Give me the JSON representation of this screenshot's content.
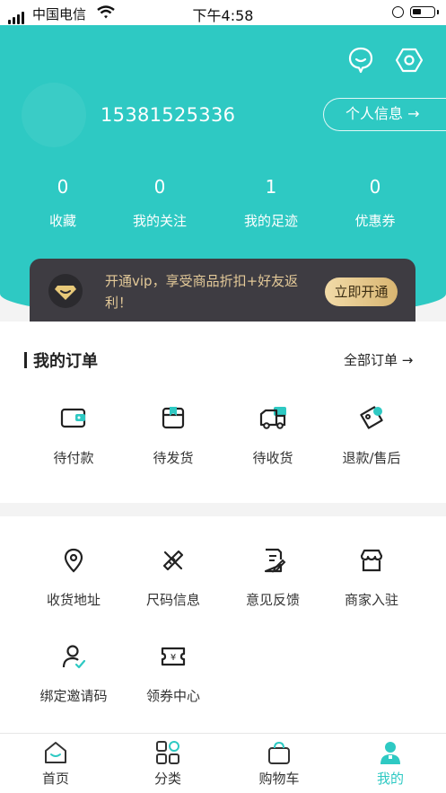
{
  "status_bar": {
    "carrier": "中国电信",
    "time": "下午4:58"
  },
  "profile": {
    "phone": "15381525336",
    "info_button": "个人信息 →"
  },
  "stats": [
    {
      "value": "0",
      "label": "收藏"
    },
    {
      "value": "0",
      "label": "我的关注"
    },
    {
      "value": "1",
      "label": "我的足迹"
    },
    {
      "value": "0",
      "label": "优惠券"
    }
  ],
  "vip": {
    "text": "开通vip，享受商品折扣+好友返利！",
    "button": "立即开通"
  },
  "orders": {
    "title": "我的订单",
    "all": "全部订单 →",
    "items": [
      {
        "label": "待付款",
        "icon": "wallet-icon"
      },
      {
        "label": "待发货",
        "icon": "package-icon"
      },
      {
        "label": "待收货",
        "icon": "truck-icon"
      },
      {
        "label": "退款/售后",
        "icon": "refund-icon"
      }
    ]
  },
  "services": [
    {
      "label": "收货地址",
      "icon": "location-icon"
    },
    {
      "label": "尺码信息",
      "icon": "ruler-pen-icon"
    },
    {
      "label": "意见反馈",
      "icon": "feedback-icon"
    },
    {
      "label": "商家入驻",
      "icon": "store-icon"
    },
    {
      "label": "绑定邀请码",
      "icon": "user-check-icon"
    },
    {
      "label": "领券中心",
      "icon": "coupon-icon"
    }
  ],
  "tabs": [
    {
      "label": "首页",
      "icon": "home-icon"
    },
    {
      "label": "分类",
      "icon": "category-icon"
    },
    {
      "label": "购物车",
      "icon": "cart-icon"
    },
    {
      "label": "我的",
      "icon": "user-icon",
      "active": true
    }
  ],
  "colors": {
    "accent": "#2ec9c3",
    "vip_bg": "#3e3c42",
    "vip_text": "#e3c998"
  }
}
